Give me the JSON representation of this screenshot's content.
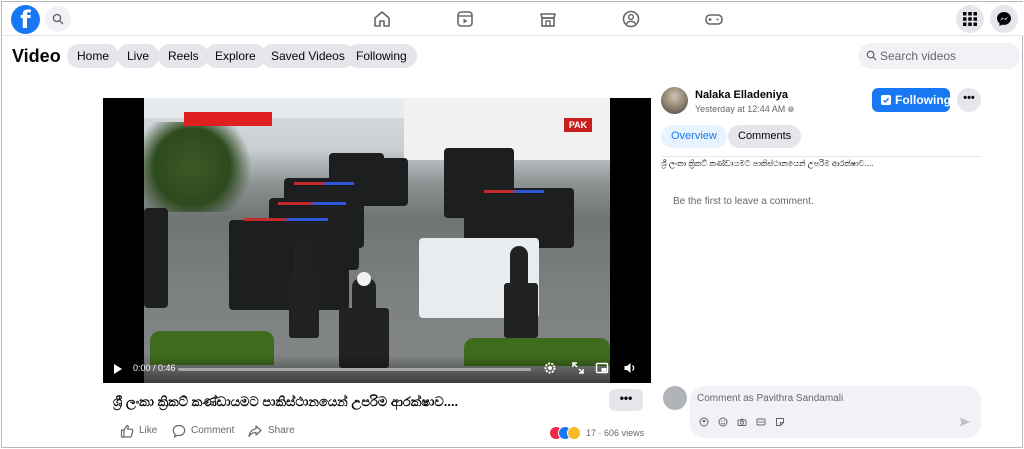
{
  "topbar": {
    "logo": "f",
    "nav_icons": [
      "home-icon",
      "video-icon",
      "marketplace-icon",
      "groups-icon",
      "gaming-icon"
    ],
    "right_icons": [
      "menu-grid-icon",
      "messenger-icon"
    ]
  },
  "video_header": {
    "title": "Video",
    "tabs": [
      "Home",
      "Live",
      "Reels",
      "Explore",
      "Saved Videos",
      "Following"
    ],
    "search_placeholder": "Search videos"
  },
  "player": {
    "time": "0:00 / 0:46",
    "overlay_sign": "PAK",
    "progress": 0
  },
  "post": {
    "caption": "ශ්‍රී ලංකා ක්‍රිකට් කණ්ඩායමට පාකිස්ථානයෙන් උපරිම ආරක්ෂාව....",
    "more_label": "•••",
    "actions": {
      "like": "Like",
      "comment": "Comment",
      "share": "Share"
    },
    "reaction_count": "17",
    "views": "606 views",
    "stats_sep": "·"
  },
  "author_panel": {
    "name": "Nalaka Elladeniya",
    "posted": "Yesterday at 12:44 AM",
    "privacy_icon": "globe-icon",
    "follow_label": "Following",
    "more_label": "•••",
    "tabs": [
      "Overview",
      "Comments"
    ],
    "description": "ශ්‍රී ලංකා ක්‍රිකට් කණ්ඩායමට පාකිස්ථානයෙන් උපරිම ආරක්ෂාව....",
    "empty_comments": "Be the first to leave a comment.",
    "comment_placeholder": "Comment as Pavithra Sandamali"
  },
  "colors": {
    "accent": "#1877f2",
    "pill": "#e4e6eb",
    "muted": "#65676b"
  }
}
